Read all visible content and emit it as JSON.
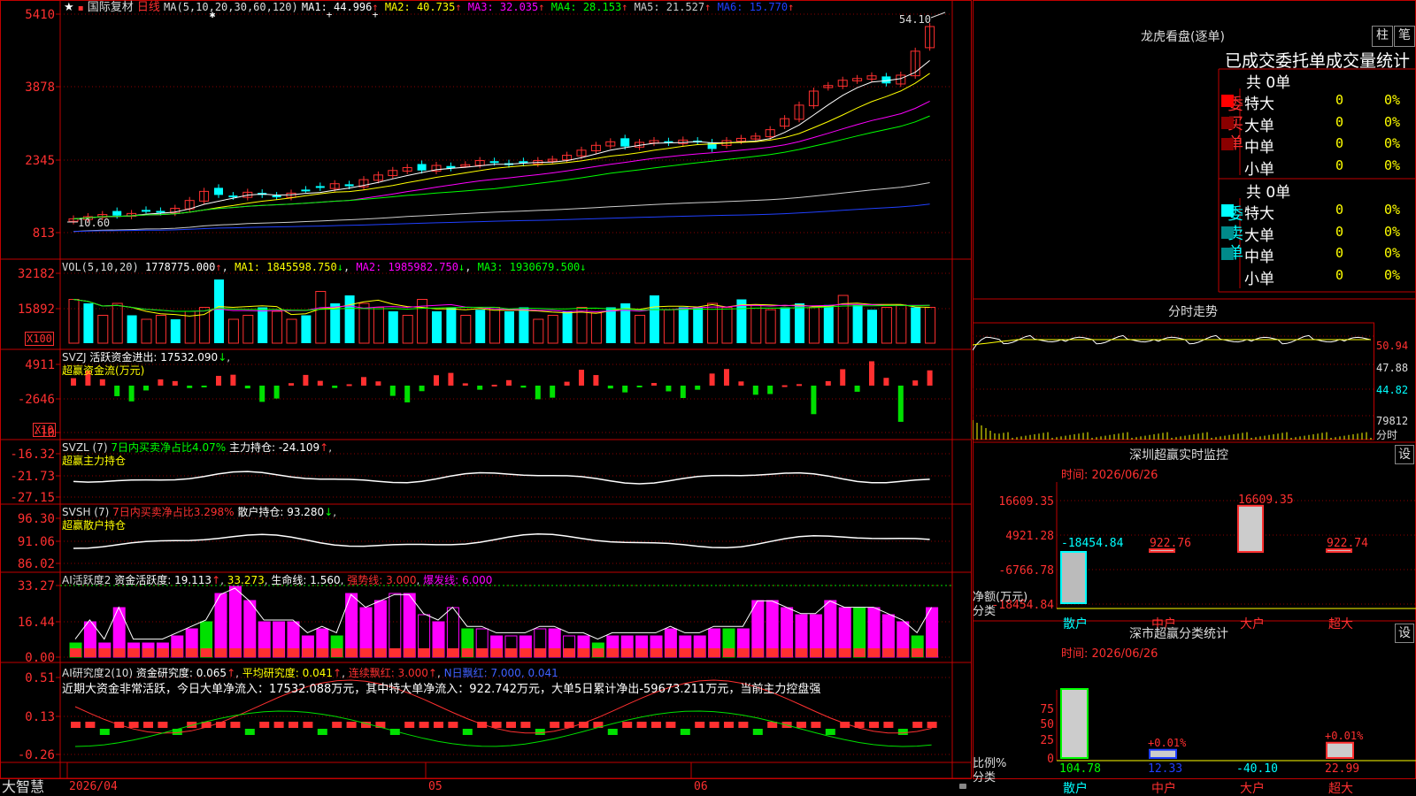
{
  "colors": {
    "up": "#ff3030",
    "down": "#00ffff",
    "ma1": "#ffffff",
    "ma2": "#ffff00",
    "ma3": "#ff00ff",
    "ma4": "#00ff00",
    "ma5": "#cccccc",
    "ma6": "#2040ff",
    "grid": "#8b0000",
    "border": "#c00000",
    "green": "#00e000"
  },
  "main": {
    "stock_name": "国际复材",
    "period": "日线",
    "ma_params": "MA(5,10,20,30,60,120)",
    "ma": [
      {
        "label": "MA1:",
        "value": "44.996"
      },
      {
        "label": "MA2:",
        "value": "40.735"
      },
      {
        "label": "MA3:",
        "value": "32.035"
      },
      {
        "label": "MA4:",
        "value": "28.153"
      },
      {
        "label": "MA5:",
        "value": "21.527"
      },
      {
        "label": "MA6:",
        "value": "15.770"
      }
    ],
    "high_marker": "54.10",
    "low_marker": "10.60",
    "y_labels": [
      "5410",
      "3878",
      "2345",
      "813"
    ]
  },
  "vol": {
    "title": "VOL(5,10,20)",
    "value": "1778775.000",
    "ma1": "MA1: 1845598.750",
    "ma2": "MA2: 1985982.750",
    "ma3": "MA3: 1930679.500",
    "y_labels": [
      "32182",
      "15892"
    ],
    "multiplier": "X100"
  },
  "svzj": {
    "title": "SVZJ",
    "label": "活跃资金进出: 17532.090",
    "sub": "超赢资金流(万元)",
    "y_labels": [
      "4911",
      "-2646",
      "-10"
    ],
    "multiplier": "X10"
  },
  "svzl": {
    "title": "SVZL (7)",
    "net": "7日内买卖净占比4.07%",
    "hold": "主力持仓: -24.109",
    "sub": "超赢主力持仓",
    "y_labels": [
      "-16.32",
      "-21.73",
      "-27.15"
    ]
  },
  "svsh": {
    "title": "SVSH (7)",
    "net": "7日内买卖净占比3.298%",
    "hold": "散户持仓: 93.280",
    "sub": "超赢散户持仓",
    "y_labels": [
      "96.30",
      "91.06",
      "86.02"
    ]
  },
  "aihyd": {
    "title": "AI活跃度2",
    "act": "资金活跃度: 19.113",
    "v2": "33.273",
    "life": "生命线: 1.560",
    "strong": "强势线: 3.000",
    "burst": "爆发线: 6.000",
    "y_labels": [
      "33.27",
      "16.44",
      "0.00"
    ]
  },
  "aiyjd": {
    "title": "AI研究度2(10)",
    "r1": "资金研究度: 0.065",
    "r2": "平均研究度: 0.041",
    "r3": "连续飘红: 3.000",
    "r4": "N日飘红: 7.000, 0.041",
    "summary": "近期大资金非常活跃，今日大单净流入：17532.088万元，其中特大单净流入：922.742万元，大单5日累计净出-59673.211万元，当前主力控盘强",
    "y_labels": [
      "0.51",
      "0.13",
      "-0.26"
    ]
  },
  "bottom": {
    "brand": "大智慧",
    "date_start": "2026/04",
    "m05": "05",
    "m06": "06"
  },
  "lhb": {
    "title": "龙虎看盘(逐单)",
    "btn1": "柱",
    "btn2": "笔",
    "tabs": "已成交委托单成交量统计",
    "buy": {
      "side": "委买单",
      "total": "共 0单",
      "rows": [
        {
          "name": "特大",
          "v": "0",
          "p": "0%"
        },
        {
          "name": "大单",
          "v": "0",
          "p": "0%"
        },
        {
          "name": "中单",
          "v": "0",
          "p": "0%"
        },
        {
          "name": "小单",
          "v": "0",
          "p": "0%"
        }
      ]
    },
    "sell": {
      "side": "委卖单",
      "total": "共 0单",
      "rows": [
        {
          "name": "特大",
          "v": "0",
          "p": "0%"
        },
        {
          "name": "大单",
          "v": "0",
          "p": "0%"
        },
        {
          "name": "中单",
          "v": "0",
          "p": "0%"
        },
        {
          "name": "小单",
          "v": "0",
          "p": "0%"
        }
      ]
    }
  },
  "fenshi": {
    "title": "分时走势",
    "y_labels": [
      "50.94",
      "47.88",
      "44.82",
      "79812",
      "分时"
    ]
  },
  "szjk": {
    "title": "深圳超赢实时监控",
    "set": "设",
    "time": "时间: 2026/06/26",
    "y_labels": [
      "16609.35",
      "4921.28",
      "-6766.78",
      "-18454.84"
    ],
    "ylabel1": "净额(万元)",
    "ylabel2": "分类",
    "bars": [
      {
        "cat": "散户",
        "value": "-18454.84"
      },
      {
        "cat": "中户",
        "value": "922.76"
      },
      {
        "cat": "大户",
        "value": "16609.35"
      },
      {
        "cat": "超大",
        "value": "922.74"
      }
    ]
  },
  "flzj": {
    "title": "深市超赢分类统计",
    "set": "设",
    "time": "时间: 2026/06/26",
    "y_labels": [
      "75",
      "50",
      "25",
      "0"
    ],
    "ylabel1": "比例%",
    "ylabel2": "分类",
    "bars": [
      {
        "cat": "散户",
        "value": "104.78",
        "pct": ""
      },
      {
        "cat": "中户",
        "value": "12.33",
        "pct": "+0.01%"
      },
      {
        "cat": "大户",
        "value": "-40.10",
        "pct": ""
      },
      {
        "cat": "超大",
        "value": "22.99",
        "pct": "+0.01%"
      }
    ]
  }
}
